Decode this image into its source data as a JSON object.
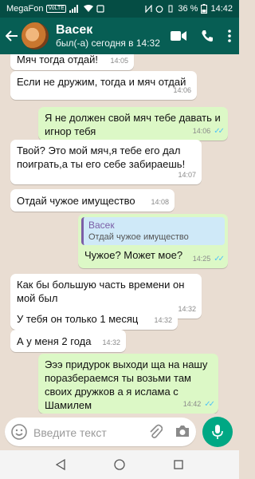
{
  "status_bar": {
    "carrier": "MegaFon",
    "badge": "VoLTE",
    "battery": "36 %",
    "time": "14:42"
  },
  "header": {
    "contact_name": "Васек",
    "last_seen": "был(-а) сегодня в 14:32"
  },
  "messages": [
    {
      "text": "Мяч тогда отдай!",
      "time": "14:05",
      "dir": "in"
    },
    {
      "text": "Если не дружим, тогда и мяч отдай",
      "time": "14:06",
      "dir": "in"
    },
    {
      "text": "Я не должен свой мяч тебе давать и игнор тебя",
      "time": "14:06",
      "dir": "out",
      "read": true
    },
    {
      "text": "Твой? Это мой мяч,я тебе его дал поиграть,а ты его себе забираешь!",
      "time": "14:07",
      "dir": "in"
    },
    {
      "text": "Отдай чужое имущество",
      "time": "14:08",
      "dir": "in"
    },
    {
      "reply_name": "Васек",
      "reply_text": "Отдай чужое имущество",
      "text": "Чужое? Может мое?",
      "time": "14:25",
      "dir": "out",
      "read": true
    },
    {
      "text": "Как бы большую часть времени он мой был",
      "time": "14:32",
      "dir": "in"
    },
    {
      "text": "У тебя он только 1 месяц",
      "time": "14:32",
      "dir": "in"
    },
    {
      "text": "А у меня 2 года",
      "time": "14:32",
      "dir": "in"
    },
    {
      "text": "Эээ придурок выходи ща на нашу поразбераемся ты возьми там своих дружков а я ислама с Шамилем",
      "time": "14:42",
      "dir": "out",
      "read": true
    }
  ],
  "input": {
    "placeholder": "Введите текст"
  },
  "colors": {
    "header": "#075e54",
    "status": "#054d44",
    "outgoing": "#dcf8c6",
    "incoming": "#ffffff",
    "accent": "#00a884",
    "ticks": "#4fc3f7"
  },
  "icons": [
    "back-arrow-icon",
    "video-call-icon",
    "phone-icon",
    "menu-dots-icon",
    "emoji-icon",
    "attach-icon",
    "camera-icon",
    "mic-icon"
  ]
}
